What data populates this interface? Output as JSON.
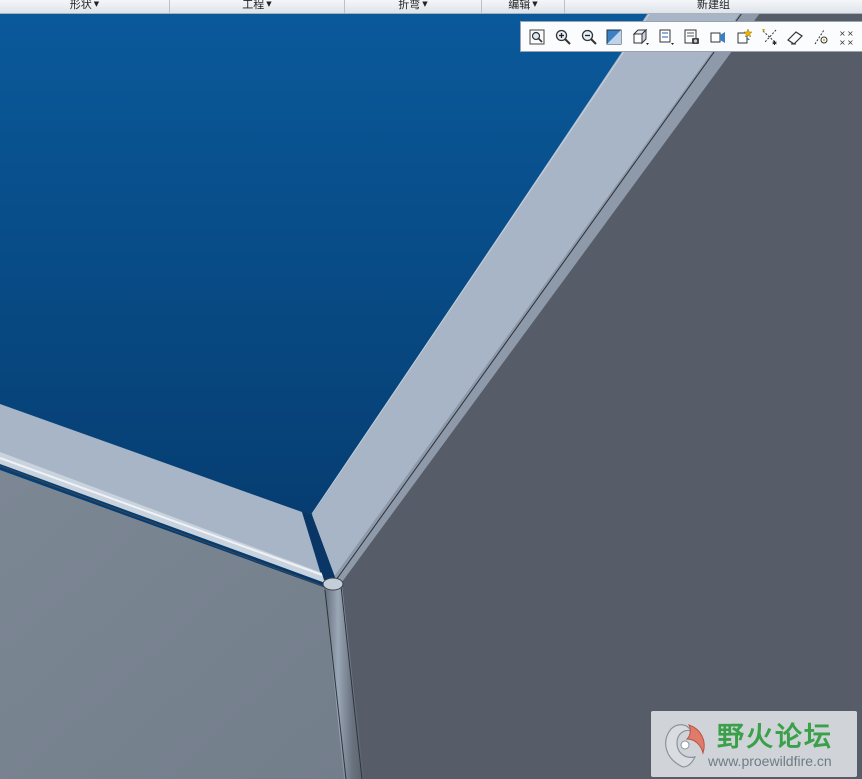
{
  "ribbon": {
    "groups": [
      {
        "label": "形状"
      },
      {
        "label": "工程"
      },
      {
        "label": "折弯"
      },
      {
        "label": "编辑"
      },
      {
        "label": "新建组"
      }
    ]
  },
  "toolbar": {
    "buttons": [
      {
        "name": "refit-icon"
      },
      {
        "name": "zoom-in-icon"
      },
      {
        "name": "zoom-out-icon"
      },
      {
        "name": "repaint-icon"
      },
      {
        "name": "display-style-icon"
      },
      {
        "name": "saved-orientations-icon"
      },
      {
        "name": "view-manager-icon"
      },
      {
        "name": "perspective-icon"
      },
      {
        "name": "spin-center-icon"
      },
      {
        "name": "datum-planes-icon"
      },
      {
        "name": "datum-axes-icon"
      },
      {
        "name": "datum-points-icon"
      },
      {
        "name": "coordinate-systems-icon"
      }
    ]
  },
  "colors": {
    "background_top": "#0a5a9c",
    "background_bottom": "#042f5c",
    "flange": "#a8b5c6",
    "face_left": "#7a8592",
    "face_right": "#565d68"
  },
  "watermark": {
    "title": "野火论坛",
    "url": "www.proewildfire.cn"
  }
}
